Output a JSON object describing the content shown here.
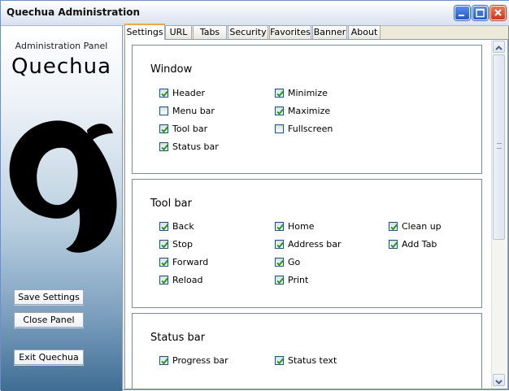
{
  "window": {
    "title": "Quechua Administration"
  },
  "sidebar": {
    "panel_label": "Administration Panel",
    "brand": "Quechua",
    "buttons": {
      "save": "Save Settings",
      "close": "Close Panel",
      "exit": "Exit Quechua"
    }
  },
  "tabs": [
    "Settings",
    "URL",
    "Tabs",
    "Security",
    "Favorites",
    "Banner",
    "About"
  ],
  "groups": {
    "window": {
      "title": "Window",
      "items": [
        {
          "label": "Header",
          "checked": true
        },
        {
          "label": "Menu bar",
          "checked": false
        },
        {
          "label": "Tool bar",
          "checked": true
        },
        {
          "label": "Status bar",
          "checked": true
        },
        {
          "label": "Minimize",
          "checked": true
        },
        {
          "label": "Maximize",
          "checked": true
        },
        {
          "label": "Fullscreen",
          "checked": false
        }
      ]
    },
    "toolbar": {
      "title": "Tool bar",
      "items": [
        {
          "label": "Back",
          "checked": true
        },
        {
          "label": "Stop",
          "checked": true
        },
        {
          "label": "Forward",
          "checked": true
        },
        {
          "label": "Reload",
          "checked": true
        },
        {
          "label": "Home",
          "checked": true
        },
        {
          "label": "Address bar",
          "checked": true
        },
        {
          "label": "Go",
          "checked": true
        },
        {
          "label": "Print",
          "checked": true
        },
        {
          "label": "Clean up",
          "checked": true
        },
        {
          "label": "Add Tab",
          "checked": true
        }
      ]
    },
    "statusbar": {
      "title": "Status bar",
      "items": [
        {
          "label": "Progress bar",
          "checked": true
        },
        {
          "label": "Status text",
          "checked": true
        }
      ]
    }
  },
  "colors": {
    "accent_tab": "#f4a73a",
    "check": "#1f9a1f",
    "title_close": "#d24a26"
  },
  "icons": [
    "minimize-icon",
    "maximize-icon",
    "close-icon",
    "quechua-logo",
    "checkmark-icon",
    "scroll-up-icon",
    "scroll-down-icon"
  ]
}
